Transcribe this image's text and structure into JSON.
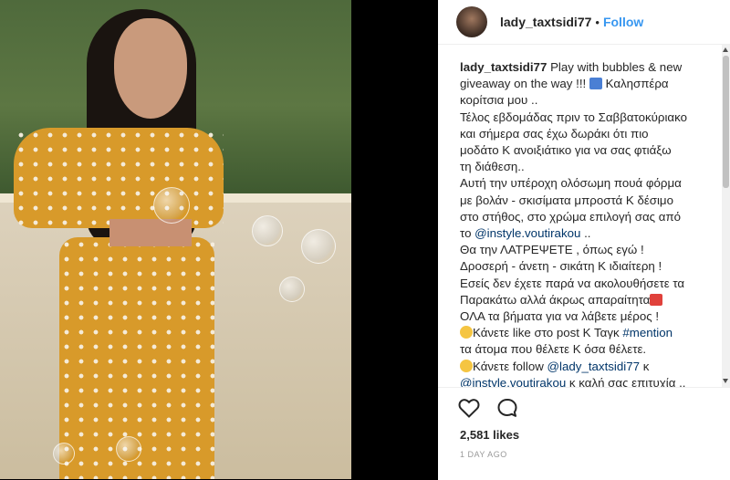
{
  "post": {
    "username": "lady_taxtsidi77",
    "separator": "•",
    "follow_label": "Follow"
  },
  "caption": {
    "author": "lady_taxtsidi77",
    "l1": "Play with bubbles & new",
    "l2": "giveaway on the way !!! ",
    "l2b": " Καλησπέρα",
    "l3": "κορίτσια μου ..",
    "l4": "Τέλος εβδομάδας πριν το Σαββατοκύριακο",
    "l5": "και σήμερα σας έχω δωράκι ότι πιο",
    "l6": "μοδάτο Κ ανοιξιάτικο για να σας φτιάξω",
    "l7": "τη διάθεση..",
    "l8": "Αυτή την υπέροχη ολόσωμη πουά φόρμα",
    "l9": "με βολάν - σκισίματα μπροστά Κ δέσιμο",
    "l10": "στο στήθος, στο χρώμα επιλογή σας από",
    "l11a": "το ",
    "l11link": "@instyle.voutirakou",
    "l11b": " ..",
    "l12": "Θα την ΛΑΤΡΕΨΕΤΕ , όπως εγώ !",
    "l13": "Δροσερή - άνετη - σικάτη Κ ιδιαίτερη !",
    "l14": "Εσείς δεν έχετε παρά να ακολουθήσετε τα",
    "l15": "Παρακάτω αλλά άκρως απαραίτητα",
    "l16": "ΟΛΑ τα βήματα για να λάβετε μέρος !",
    "l17a": "Κάνετε like στο post Κ Ταγκ ",
    "l17link": "#mention",
    "l18": "τα άτομα που θέλετε Κ όσα θέλετε.",
    "l19a": "Κάνετε follow ",
    "l19link": "@lady_taxtsidi77",
    "l19b": " κ",
    "l20link": "@instyle.voutirakou",
    "l20b": " κ καλή σας επιτυχία .."
  },
  "stats": {
    "likes": "2,581 likes",
    "time_ago": "1 DAY AGO"
  },
  "colors": {
    "link": "#003569",
    "follow": "#3897f0",
    "emoji_blue": "#4a7fd4",
    "emoji_red": "#e0413b"
  },
  "icons": [
    "heart-icon",
    "comment-icon"
  ]
}
